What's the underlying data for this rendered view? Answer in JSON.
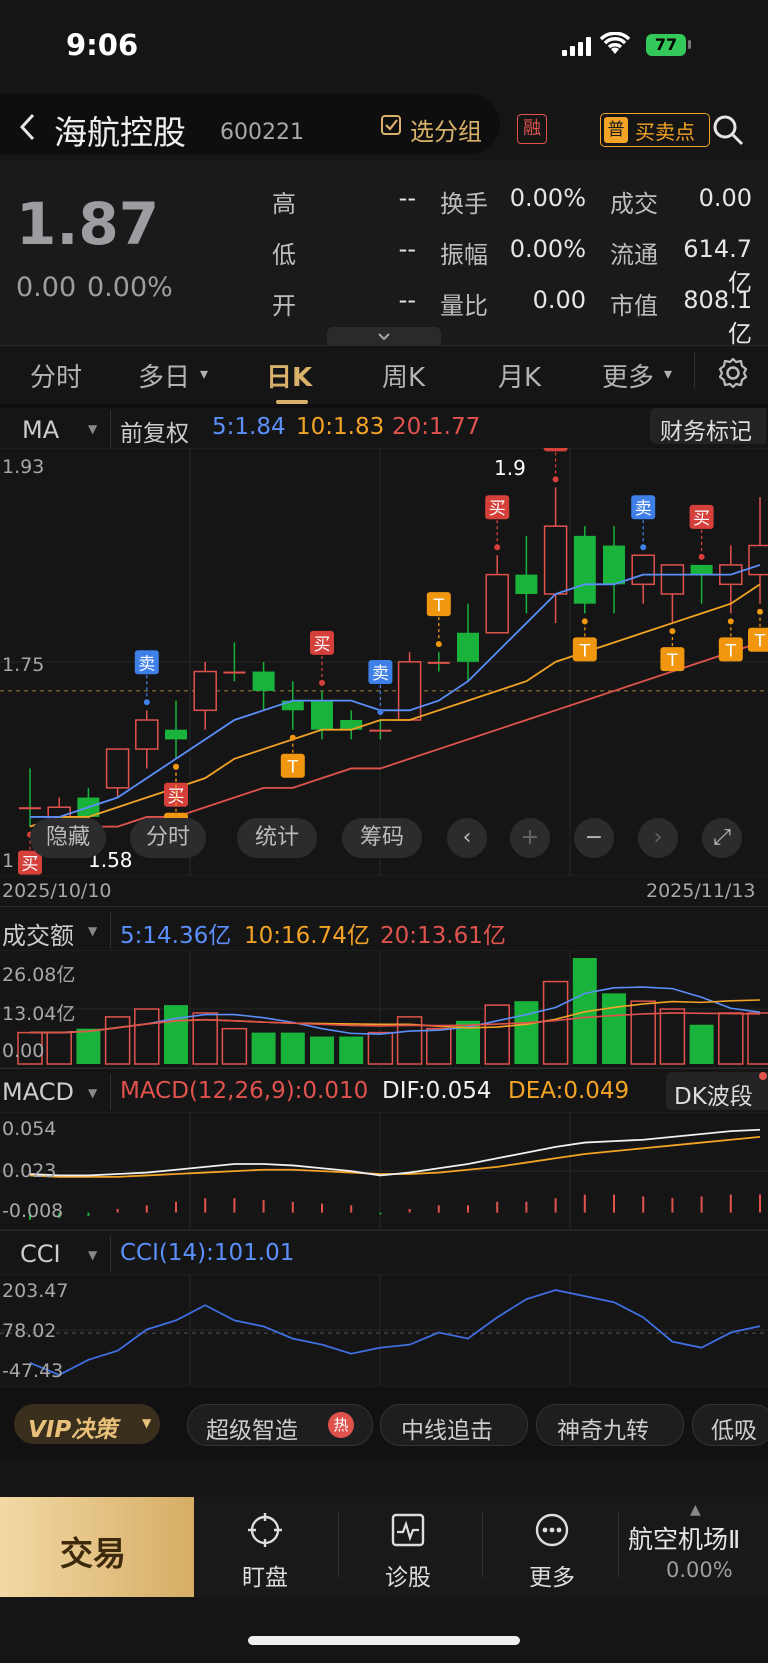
{
  "status": {
    "time": "9:06",
    "battery": "77"
  },
  "header": {
    "title": "海航控股",
    "code": "600221",
    "group_label": "选分组",
    "rong_label": "融",
    "pu_label": "普",
    "buysell_label": "买卖点"
  },
  "quote": {
    "price": "1.87",
    "change": "0.00",
    "change_pct": "0.00%",
    "rows": [
      [
        {
          "k": "高",
          "v": "--"
        },
        {
          "k": "换手",
          "v": "0.00%"
        },
        {
          "k": "成交",
          "v": "0.00"
        }
      ],
      [
        {
          "k": "低",
          "v": "--"
        },
        {
          "k": "振幅",
          "v": "0.00%"
        },
        {
          "k": "流通",
          "v": "614.7亿"
        }
      ],
      [
        {
          "k": "开",
          "v": "--"
        },
        {
          "k": "量比",
          "v": "0.00"
        },
        {
          "k": "市值",
          "v": "808.1亿"
        }
      ]
    ]
  },
  "tabs": [
    "分时",
    "多日",
    "日K",
    "周K",
    "月K",
    "更多"
  ],
  "active_tab": "日K",
  "ma_bar": {
    "ma_label": "MA",
    "fq": "前复权",
    "ma5": "5:1.84",
    "ma10": "10:1.83",
    "ma20": "20:1.77",
    "fin_mark": "财务标记"
  },
  "kline": {
    "y_top": "1.93",
    "y_mid": "1.75",
    "y_bottom_partial": "1",
    "low_label": "1.58",
    "high_label": "1.9",
    "date_start": "2025/10/10",
    "date_end": "2025/11/13",
    "buttons": {
      "hide": "隐藏",
      "fenshi": "分时",
      "stat": "统计",
      "chip": "筹码"
    },
    "signal_buy": "买",
    "signal_sell": "卖",
    "signal_t": "T",
    "candles": [
      {
        "o": 1.6,
        "h": 1.64,
        "l": 1.58,
        "c": 1.6,
        "up": false,
        "flat": true
      },
      {
        "o": 1.57,
        "h": 1.61,
        "l": 1.56,
        "c": 1.6,
        "up": true
      },
      {
        "o": 1.61,
        "h": 1.62,
        "l": 1.58,
        "c": 1.59,
        "up": false
      },
      {
        "o": 1.62,
        "h": 1.66,
        "l": 1.61,
        "c": 1.66,
        "up": true
      },
      {
        "o": 1.66,
        "h": 1.7,
        "l": 1.64,
        "c": 1.69,
        "up": true
      },
      {
        "o": 1.68,
        "h": 1.71,
        "l": 1.65,
        "c": 1.67,
        "up": false
      },
      {
        "o": 1.7,
        "h": 1.75,
        "l": 1.68,
        "c": 1.74,
        "up": true
      },
      {
        "o": 1.74,
        "h": 1.77,
        "l": 1.73,
        "c": 1.74,
        "up": false,
        "flat": true
      },
      {
        "o": 1.74,
        "h": 1.75,
        "l": 1.7,
        "c": 1.72,
        "up": false
      },
      {
        "o": 1.71,
        "h": 1.73,
        "l": 1.68,
        "c": 1.7,
        "up": false
      },
      {
        "o": 1.71,
        "h": 1.72,
        "l": 1.67,
        "c": 1.68,
        "up": false
      },
      {
        "o": 1.69,
        "h": 1.7,
        "l": 1.67,
        "c": 1.68,
        "up": false
      },
      {
        "o": 1.68,
        "h": 1.69,
        "l": 1.67,
        "c": 1.68,
        "up": false,
        "flat": true
      },
      {
        "o": 1.69,
        "h": 1.76,
        "l": 1.69,
        "c": 1.75,
        "up": true
      },
      {
        "o": 1.75,
        "h": 1.76,
        "l": 1.74,
        "c": 1.75,
        "up": false,
        "flat": true
      },
      {
        "o": 1.75,
        "h": 1.81,
        "l": 1.73,
        "c": 1.78,
        "up": false
      },
      {
        "o": 1.78,
        "h": 1.86,
        "l": 1.78,
        "c": 1.84,
        "up": true
      },
      {
        "o": 1.84,
        "h": 1.88,
        "l": 1.8,
        "c": 1.82,
        "up": false
      },
      {
        "o": 1.82,
        "h": 1.93,
        "l": 1.79,
        "c": 1.89,
        "up": true
      },
      {
        "o": 1.88,
        "h": 1.89,
        "l": 1.8,
        "c": 1.81,
        "up": false
      },
      {
        "o": 1.87,
        "h": 1.89,
        "l": 1.8,
        "c": 1.83,
        "up": false
      },
      {
        "o": 1.86,
        "h": 1.86,
        "l": 1.81,
        "c": 1.83,
        "up": true
      },
      {
        "o": 1.82,
        "h": 1.85,
        "l": 1.79,
        "c": 1.85,
        "up": true
      },
      {
        "o": 1.85,
        "h": 1.85,
        "l": 1.81,
        "c": 1.84,
        "up": false
      },
      {
        "o": 1.85,
        "h": 1.87,
        "l": 1.8,
        "c": 1.83,
        "up": true
      },
      {
        "o": 1.84,
        "h": 1.92,
        "l": 1.81,
        "c": 1.87,
        "up": true
      }
    ],
    "ma5": [
      1.59,
      1.59,
      1.6,
      1.61,
      1.63,
      1.65,
      1.67,
      1.69,
      1.7,
      1.71,
      1.71,
      1.71,
      1.7,
      1.7,
      1.71,
      1.73,
      1.76,
      1.79,
      1.82,
      1.83,
      1.83,
      1.84,
      1.84,
      1.84,
      1.84,
      1.85
    ],
    "ma10": [
      1.58,
      1.59,
      1.59,
      1.6,
      1.61,
      1.62,
      1.63,
      1.65,
      1.66,
      1.67,
      1.68,
      1.68,
      1.69,
      1.69,
      1.7,
      1.71,
      1.72,
      1.73,
      1.75,
      1.76,
      1.77,
      1.78,
      1.79,
      1.8,
      1.81,
      1.83
    ],
    "ma20": [
      1.57,
      1.58,
      1.58,
      1.58,
      1.59,
      1.59,
      1.6,
      1.61,
      1.62,
      1.62,
      1.63,
      1.64,
      1.64,
      1.65,
      1.66,
      1.67,
      1.68,
      1.69,
      1.7,
      1.71,
      1.72,
      1.73,
      1.74,
      1.75,
      1.76,
      1.77
    ],
    "signals": [
      {
        "i": 0,
        "t": "买",
        "pos": "below"
      },
      {
        "i": 4,
        "t": "卖",
        "pos": "above"
      },
      {
        "i": 5,
        "t": "买",
        "pos": "below"
      },
      {
        "i": 5,
        "t": "T",
        "pos": "below"
      },
      {
        "i": 9,
        "t": "T",
        "pos": "below"
      },
      {
        "i": 10,
        "t": "买",
        "pos": "above"
      },
      {
        "i": 12,
        "t": "卖",
        "pos": "above"
      },
      {
        "i": 14,
        "t": "T",
        "pos": "above"
      },
      {
        "i": 16,
        "t": "买",
        "pos": "above"
      },
      {
        "i": 18,
        "t": "买",
        "pos": "above"
      },
      {
        "i": 19,
        "t": "T",
        "pos": "below"
      },
      {
        "i": 21,
        "t": "卖",
        "pos": "above"
      },
      {
        "i": 22,
        "t": "T",
        "pos": "below"
      },
      {
        "i": 23,
        "t": "买",
        "pos": "above"
      },
      {
        "i": 24,
        "t": "T",
        "pos": "below"
      },
      {
        "i": 25,
        "t": "T",
        "pos": "below"
      }
    ]
  },
  "volume": {
    "label": "成交额",
    "ma5": "5:14.36亿",
    "ma10": "10:16.74亿",
    "ma20": "20:13.61亿",
    "y_top": "26.08亿",
    "y_mid": "13.04亿",
    "y_bottom": "0.00",
    "bars": [
      8,
      8,
      9,
      12,
      14,
      15,
      13,
      9,
      8,
      8,
      7,
      7,
      8,
      12,
      9,
      11,
      15,
      16,
      21,
      27,
      18,
      16,
      14,
      10,
      13,
      13
    ]
  },
  "macd": {
    "label": "MACD",
    "params": "MACD(12,26,9):0.010",
    "dif": "DIF:0.054",
    "dea": "DEA:0.049",
    "dk": "DK波段",
    "y_top": "0.054",
    "y_mid": "0.023",
    "y_bottom": "-0.008",
    "hist": [
      -0.004,
      -0.003,
      -0.002,
      0.002,
      0.004,
      0.006,
      0.008,
      0.008,
      0.007,
      0.006,
      0.005,
      0.004,
      -0.001,
      0.002,
      0.004,
      0.004,
      0.006,
      0.006,
      0.008,
      0.01,
      0.01,
      0.009,
      0.008,
      0.009,
      0.01,
      0.01
    ],
    "dif_series": [
      0.023,
      0.022,
      0.022,
      0.023,
      0.024,
      0.026,
      0.028,
      0.03,
      0.03,
      0.029,
      0.027,
      0.025,
      0.022,
      0.024,
      0.027,
      0.03,
      0.034,
      0.038,
      0.042,
      0.045,
      0.046,
      0.047,
      0.049,
      0.051,
      0.053,
      0.054
    ],
    "dea_series": [
      0.022,
      0.021,
      0.021,
      0.021,
      0.022,
      0.023,
      0.024,
      0.025,
      0.026,
      0.026,
      0.025,
      0.024,
      0.023,
      0.023,
      0.024,
      0.026,
      0.028,
      0.031,
      0.034,
      0.037,
      0.039,
      0.041,
      0.043,
      0.045,
      0.047,
      0.049
    ]
  },
  "cci": {
    "label": "CCI",
    "value": "CCI(14):101.01",
    "y_top": "203.47",
    "y_mid": "78.02",
    "y_bottom": "-47.43",
    "series": [
      -20,
      -60,
      -10,
      20,
      90,
      120,
      170,
      120,
      100,
      60,
      40,
      10,
      30,
      40,
      80,
      60,
      130,
      190,
      220,
      200,
      180,
      130,
      50,
      30,
      80,
      101
    ]
  },
  "strip": {
    "vip": "VIP决策",
    "items": [
      "超级智造",
      "中线追击",
      "神奇九转",
      "低吸"
    ],
    "hot": "热"
  },
  "bottom": {
    "trade": "交易",
    "pan": "盯盘",
    "diagnose": "诊股",
    "more": "更多",
    "sector": "航空机场Ⅱ",
    "sector_pct": "0.00%"
  }
}
